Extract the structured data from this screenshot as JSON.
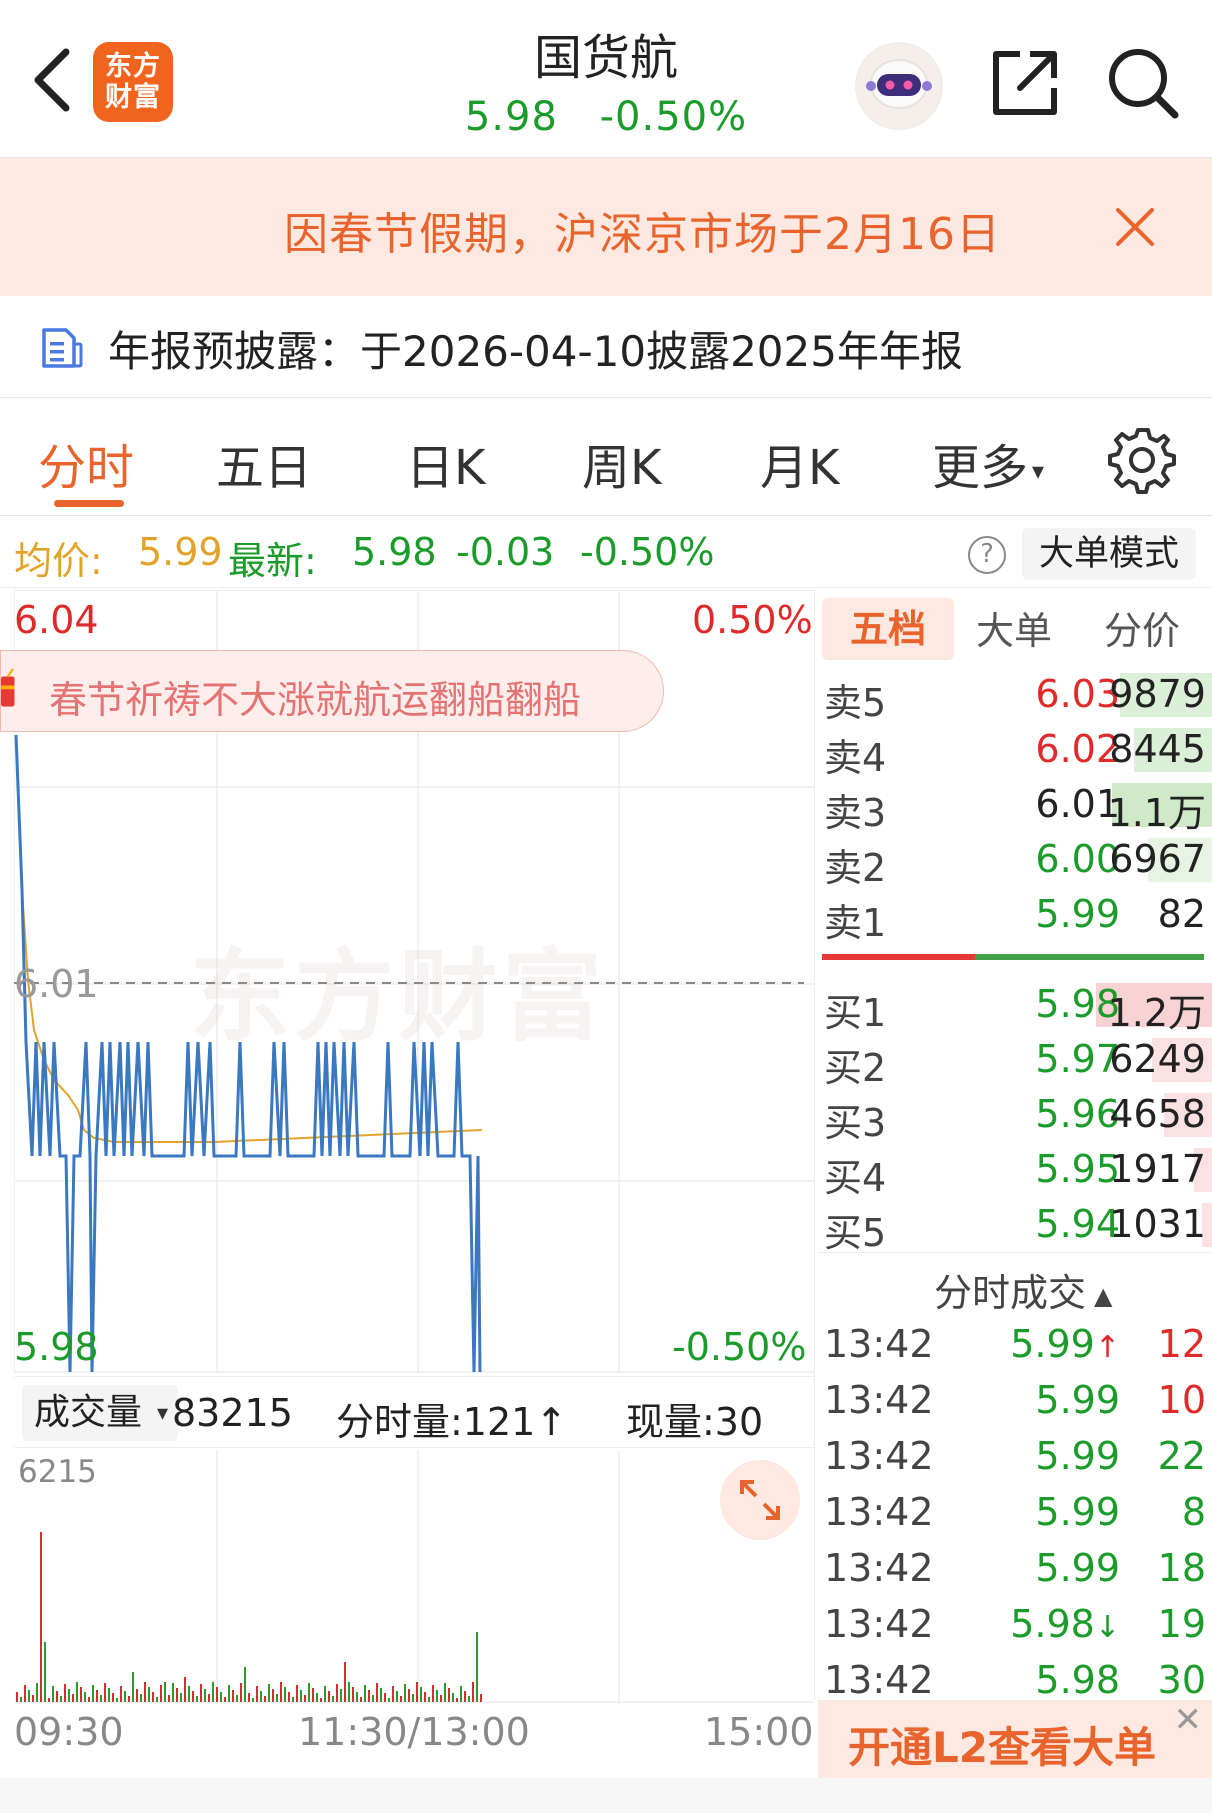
{
  "header": {
    "logo_line1": "东方",
    "logo_line2": "财富",
    "title": "国货航",
    "price": "5.98",
    "change_pct": "-0.50%"
  },
  "notice": {
    "text": "因春节假期，沪深京市场于2月16日"
  },
  "report": {
    "text": "年报预披露：于2026-04-10披露2025年年报"
  },
  "tabs": [
    {
      "label": "分时",
      "active": true
    },
    {
      "label": "五日"
    },
    {
      "label": "日K"
    },
    {
      "label": "周K"
    },
    {
      "label": "月K"
    },
    {
      "label": "更多"
    }
  ],
  "stat": {
    "avg_label": "均价:",
    "avg_value": "5.99",
    "latest_label": "最新:",
    "latest_value": "5.98",
    "change": "-0.03",
    "change_pct": "-0.50%",
    "help": "?",
    "big_mode": "大单模式"
  },
  "chart_labels": {
    "price_high": "6.04",
    "pct_high": "0.50%",
    "price_mid": "6.01",
    "price_low": "5.98",
    "pct_low": "-0.50%",
    "tag": "春节祈祷不大涨就航运翻船翻船",
    "watermark": "东方财富"
  },
  "volume": {
    "selector": "成交量",
    "total": "83215",
    "minute_label": "分时量:121↑",
    "now_label": "现量:30",
    "max_label": "6215"
  },
  "time_axis": [
    "09:30",
    "11:30/13:00",
    "15:00"
  ],
  "orderbook": {
    "tabs": [
      "五档",
      "大单",
      "分价"
    ],
    "asks": [
      {
        "name": "卖5",
        "price": "6.03",
        "volume": "9879"
      },
      {
        "name": "卖4",
        "price": "6.02",
        "volume": "8445"
      },
      {
        "name": "卖3",
        "price": "6.01",
        "volume": "1.1万"
      },
      {
        "name": "卖2",
        "price": "6.00",
        "volume": "6967"
      },
      {
        "name": "卖1",
        "price": "5.99",
        "volume": "82"
      }
    ],
    "bids": [
      {
        "name": "买1",
        "price": "5.98",
        "volume": "1.2万"
      },
      {
        "name": "买2",
        "price": "5.97",
        "volume": "6249"
      },
      {
        "name": "买3",
        "price": "5.96",
        "volume": "4658"
      },
      {
        "name": "买4",
        "price": "5.95",
        "volume": "1917"
      },
      {
        "name": "买5",
        "price": "5.94",
        "volume": "1031"
      }
    ],
    "trades_title": "分时成交",
    "trades": [
      {
        "time": "13:42",
        "price": "5.99",
        "arrow": "↑",
        "qty": "12"
      },
      {
        "time": "13:42",
        "price": "5.99",
        "arrow": "",
        "qty": "10"
      },
      {
        "time": "13:42",
        "price": "5.99",
        "arrow": "",
        "qty": "22"
      },
      {
        "time": "13:42",
        "price": "5.99",
        "arrow": "",
        "qty": "8"
      },
      {
        "time": "13:42",
        "price": "5.99",
        "arrow": "",
        "qty": "18"
      },
      {
        "time": "13:42",
        "price": "5.98",
        "arrow": "↓",
        "qty": "19"
      },
      {
        "time": "13:42",
        "price": "5.98",
        "arrow": "",
        "qty": "30"
      }
    ],
    "l2_banner": "开通L2查看大单"
  },
  "colors": {
    "up": "#e02a2a",
    "down": "#1a9b2a",
    "accent": "#e8642c",
    "price_line": "#3a78c2",
    "avg_line": "#e3a32a"
  }
}
